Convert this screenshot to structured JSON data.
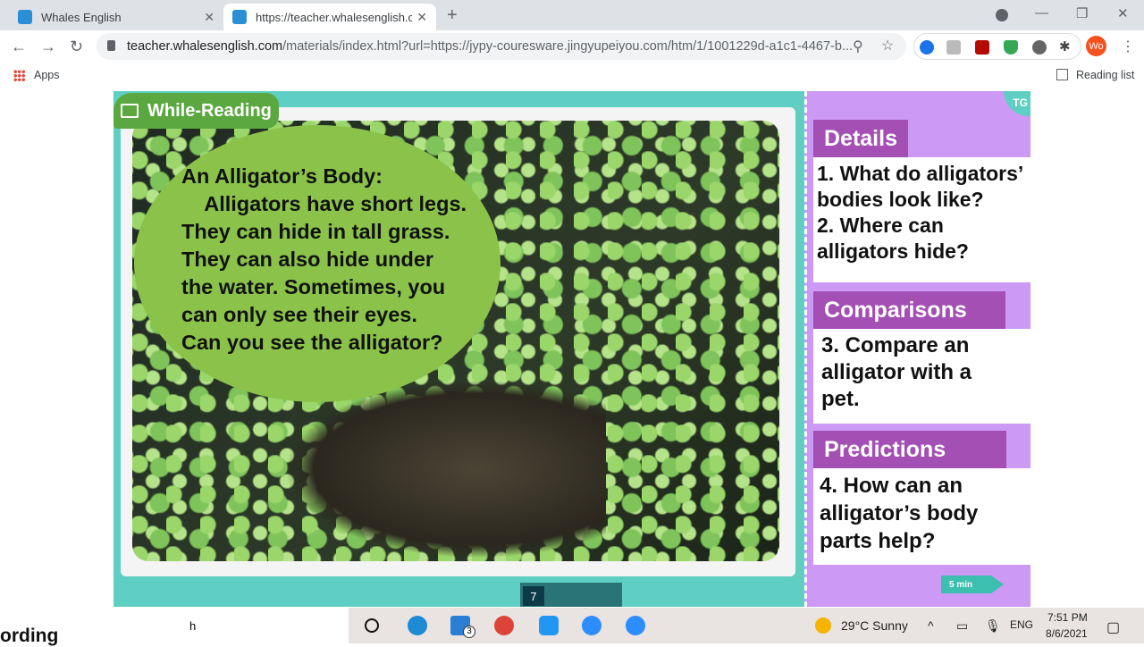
{
  "browser": {
    "tabs": [
      {
        "title": "Whales English"
      },
      {
        "title": "https://teacher.whalesenglish.com"
      }
    ],
    "url_host": "teacher.whalesenglish.com",
    "url_rest": "/materials/index.html?url=https://jypy-couresware.jingyupeiyou.com/htm/1/1001229d-a1c1-4467-b...",
    "profile": "Wo",
    "bookmarks": {
      "apps": "Apps",
      "reading_list": "Reading list"
    }
  },
  "slide": {
    "badge": "While-Reading",
    "passage": "An Alligator’s Body:\n    Alligators have short legs.\nThey can hide in tall grass.\nThey can also hide under\nthe water. Sometimes, you\ncan only see their eyes.\nCan you see the alligator?",
    "page": "7",
    "tg": "TG",
    "sections": [
      {
        "title": "Details",
        "text": "1. What do alligators’\nbodies look like?\n2. Where can\nalligators hide?"
      },
      {
        "title": "Comparisons",
        "text": "3. Compare an\nalligator with a\npet."
      },
      {
        "title": "Predictions",
        "text": "4. How can an\nalligator’s body\nparts help?"
      }
    ],
    "timer": "5 min"
  },
  "taskbar": {
    "search_fragment": "h",
    "mail_badge": "3",
    "weather": "29°C  Sunny",
    "lang": "ENG",
    "time": "7:51 PM",
    "date": "8/6/2021"
  },
  "background_text": "ording"
}
